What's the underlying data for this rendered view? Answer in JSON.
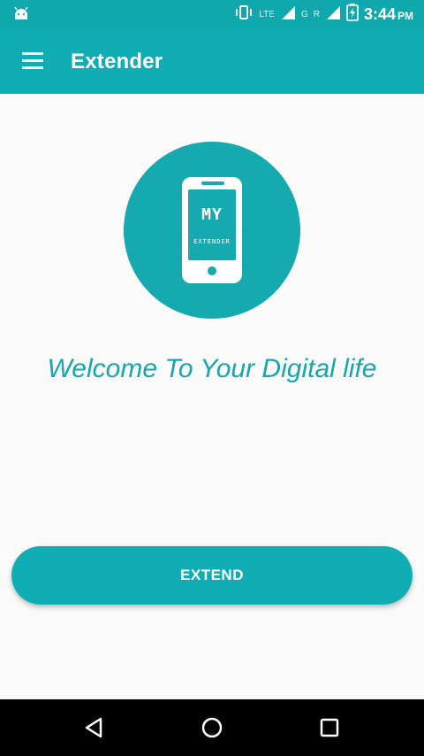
{
  "status_bar": {
    "lte_label": "LTE",
    "g_label": "G",
    "r_label": "R",
    "time": "3:44",
    "ampm": "PM",
    "icons": [
      "android-icon",
      "vibrate-icon",
      "signal-icon",
      "battery-charging-icon"
    ]
  },
  "app_bar": {
    "title": "Extender",
    "menu_icon": "menu-icon"
  },
  "logo": {
    "line1": "MY",
    "line2": "EXTENDER"
  },
  "welcome_text": "Welcome To Your Digital life",
  "extend_button": {
    "label": "EXTEND"
  },
  "nav_bar": {
    "icons": [
      "back-icon",
      "home-icon",
      "recents-icon"
    ]
  },
  "colors": {
    "primary": "#10aeb4",
    "status_bar": "#0fa8ad",
    "background": "#fafafa",
    "welcome_text": "#16a6ad",
    "nav_bar": "#000000"
  }
}
